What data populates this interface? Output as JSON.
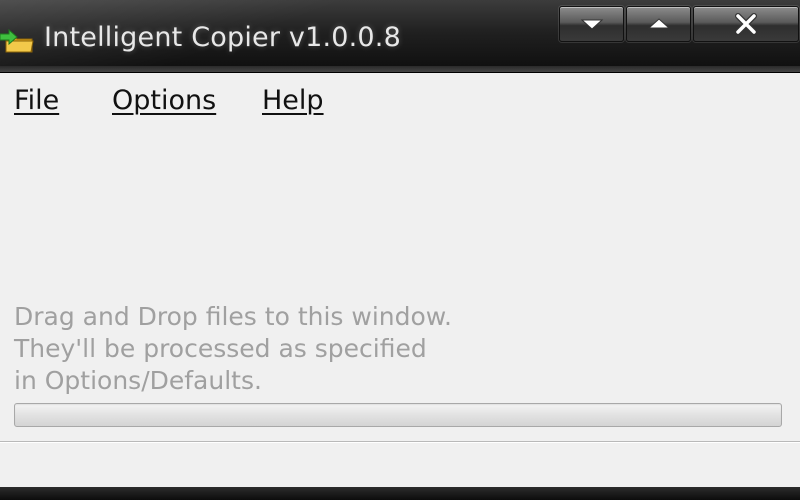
{
  "window": {
    "title": "Intelligent Copier v1.0.0.8",
    "app_icon": "folder-arrow-icon",
    "caption_buttons": [
      "minimize-icon",
      "maximize-icon",
      "close-icon"
    ]
  },
  "menu": {
    "items": [
      {
        "label": "File"
      },
      {
        "label": "Options"
      },
      {
        "label": "Help"
      }
    ]
  },
  "main": {
    "hint_lines": [
      "Drag and Drop files to this window.",
      "They'll be processed as specified",
      "in Options/Defaults."
    ],
    "progress_percent": 0
  },
  "colors": {
    "titlebar": "#1e1e1e",
    "client_bg": "#f0f0f0",
    "hint_text": "#a0a0a0"
  }
}
